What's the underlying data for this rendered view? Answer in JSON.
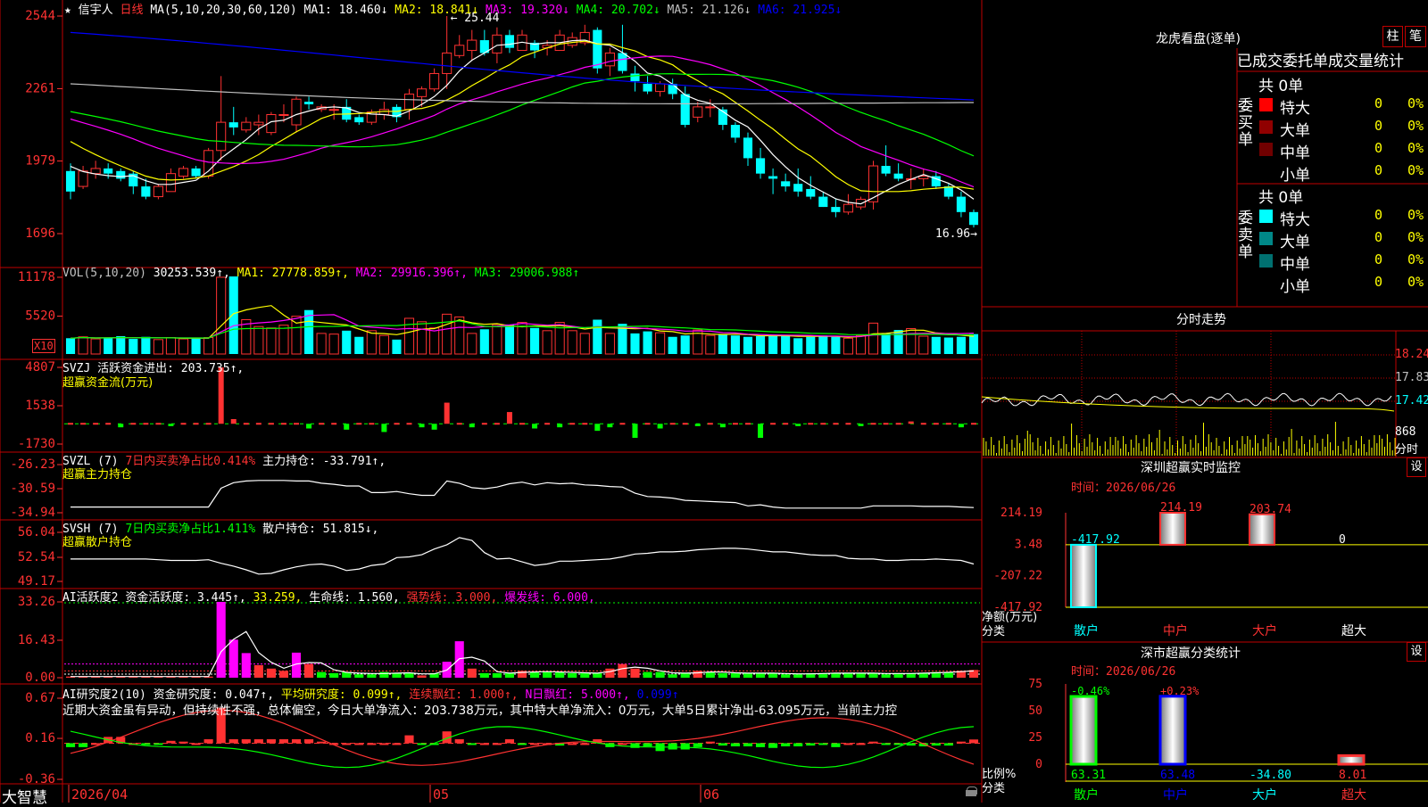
{
  "colors": {
    "up": "#ff3232",
    "down": "#00ffff",
    "grid": "#c00000",
    "ma1": "#ffffff",
    "ma2": "#ffff00",
    "ma3": "#ff00ff",
    "ma4": "#00ff00",
    "ma5": "#c0c0c0",
    "ma6": "#0000ff"
  },
  "header": {
    "star_icon": "★",
    "star_glyph": "★",
    "stock_name": "信宇人",
    "period": "日线",
    "ma_params": "MA(5,10,20,30,60,120)",
    "ma": [
      {
        "label": "MA1: 18.460↓",
        "color": "#ffffff"
      },
      {
        "label": "MA2: 18.841↓",
        "color": "#ffff00"
      },
      {
        "label": "MA3: 19.320↓",
        "color": "#ff00ff"
      },
      {
        "label": "MA4: 20.702↓",
        "color": "#00ff00"
      },
      {
        "label": "MA5: 21.126↓",
        "color": "#c0c0c0"
      },
      {
        "label": "MA6: 21.925↓",
        "color": "#0000ff"
      }
    ]
  },
  "price_axis": [
    "2544",
    "2261",
    "1979",
    "1696"
  ],
  "price_annotations": {
    "high": "25.44",
    "low": "16.96"
  },
  "vol": {
    "title": "VOL(5,10,20)",
    "value": "30253.539↑,",
    "ma1": "MA1: 27778.859↑,",
    "ma2": "MA2: 29916.396↑,",
    "ma3": "MA3: 29006.988↑",
    "axis": [
      "11178",
      "5520"
    ],
    "unit": "X10"
  },
  "svzj": {
    "title": "SVZJ  活跃资金进出: 203.735↑,",
    "subtitle": "超赢资金流(万元)",
    "axis": [
      "4807",
      "1538",
      "-1730"
    ]
  },
  "svzl": {
    "title": "SVZL (7)",
    "ratio": "7日内买卖净占比0.414%",
    "hold": "主力持仓: -33.791↑,",
    "subtitle": "超赢主力持仓",
    "axis": [
      "-26.23",
      "-30.59",
      "-34.94"
    ]
  },
  "svsh": {
    "title": "SVSH (7)",
    "ratio": "7日内买卖净占比1.411%",
    "hold": "散户持仓: 51.815↓,",
    "subtitle": "超赢散户持仓",
    "axis": [
      "56.04",
      "52.54",
      "49.17"
    ]
  },
  "ai1": {
    "title": "AI活跃度2",
    "activity": "资金活跃度: 3.445↑,",
    "v2": "33.259,",
    "life": "生命线: 1.560,",
    "strong": "强势线: 3.000,",
    "burst": "爆发线: 6.000,",
    "axis": [
      "33.26",
      "16.43",
      "0.00"
    ]
  },
  "ai2": {
    "title": "AI研究度2(10)",
    "research": "资金研究度: 0.047↑,",
    "avg": "平均研究度: 0.099↑,",
    "cont": "连续飘红: 1.000↑,",
    "nday": "N日飘红: 5.000↑,",
    "last": "0.099↑",
    "axis": [
      "0.67",
      "0.16",
      "-0.36"
    ],
    "commentary": "近期大资金虽有异动，但持续性不强，总体偏空，今日大单净流入：203.738万元，其中特大单净流入：0万元，大单5日累计净出-63.095万元，当前主力控"
  },
  "date_axis": [
    "2026/04",
    "05",
    "06"
  ],
  "brand": "大智慧",
  "lock_icon": "lock-icon",
  "right": {
    "lhb_title": "龙虎看盘(逐单)",
    "btn_zhu": "柱",
    "btn_bi": "笔",
    "tabs": [
      "已成交",
      "委托单",
      "成交量统计"
    ],
    "buy": {
      "side_label": "委买单",
      "total": "共 0单",
      "rows": [
        {
          "color": "#ff0000",
          "label": "特大",
          "count": "0",
          "pct": "0%"
        },
        {
          "color": "#900000",
          "label": "大单",
          "count": "0",
          "pct": "0%"
        },
        {
          "color": "#700000",
          "label": "中单",
          "count": "0",
          "pct": "0%"
        },
        {
          "color": "#000000",
          "label": "小单",
          "count": "0",
          "pct": "0%"
        }
      ]
    },
    "sell": {
      "side_label": "委卖单",
      "total": "共 0单",
      "rows": [
        {
          "color": "#00ffff",
          "label": "特大",
          "count": "0",
          "pct": "0%"
        },
        {
          "color": "#008888",
          "label": "大单",
          "count": "0",
          "pct": "0%"
        },
        {
          "color": "#007070",
          "label": "中单",
          "count": "0",
          "pct": "0%"
        },
        {
          "color": "#000000",
          "label": "小单",
          "count": "0",
          "pct": "0%"
        }
      ]
    },
    "fenshi_title": "分时走势",
    "fenshi_axis": [
      "18.24",
      "17.83",
      "17.42"
    ],
    "fenshi_vol": "868",
    "fenshi_unit": "分时",
    "sz_monitor": {
      "title": "深圳超赢实时监控",
      "btn": "设",
      "time": "时间：2026/06/26",
      "axis": [
        "214.19",
        "3.48",
        "-207.22",
        "-417.92"
      ],
      "y_label": "净额(万元)",
      "x_label": "分类",
      "bars": [
        {
          "cat": "散户",
          "value": -417.92,
          "label": "-417.92"
        },
        {
          "cat": "中户",
          "value": 214.19,
          "label": "214.19"
        },
        {
          "cat": "大户",
          "value": 203.74,
          "label": "203.74"
        },
        {
          "cat": "超大",
          "value": 0,
          "label": "0"
        }
      ]
    },
    "sz_class": {
      "title": "深市超赢分类统计",
      "btn": "设",
      "time": "时间：2026/06/26",
      "axis": [
        "75",
        "50",
        "25",
        "0"
      ],
      "y_label": "比例%",
      "x_label": "分类",
      "bars": [
        {
          "cat": "散户",
          "pct": "-0.46%",
          "value": 63.31,
          "label": "63.31"
        },
        {
          "cat": "中户",
          "pct": "+0.23%",
          "value": 63.48,
          "label": "63.48"
        },
        {
          "cat": "大户",
          "pct": "",
          "value": -34.8,
          "label": "-34.80"
        },
        {
          "cat": "超大",
          "pct": "",
          "value": 8.01,
          "label": "8.01"
        }
      ]
    }
  },
  "chart_data": [
    {
      "type": "candlestick",
      "name": "日线",
      "ylim": [
        16.96,
        25.44
      ],
      "ohlc": [
        [
          19.4,
          19.7,
          18.3,
          18.6
        ],
        [
          18.8,
          19.6,
          18.7,
          19.4
        ],
        [
          19.3,
          19.8,
          19.1,
          19.5
        ],
        [
          19.5,
          19.7,
          19.1,
          19.3
        ],
        [
          19.4,
          19.5,
          19.0,
          19.1
        ],
        [
          19.3,
          19.4,
          18.5,
          18.8
        ],
        [
          18.8,
          19.1,
          18.3,
          18.4
        ],
        [
          18.4,
          18.9,
          18.3,
          18.8
        ],
        [
          18.6,
          19.5,
          18.6,
          19.3
        ],
        [
          19.2,
          19.6,
          19.1,
          19.5
        ],
        [
          19.5,
          19.6,
          19.1,
          19.2
        ],
        [
          19.2,
          20.3,
          19.1,
          20.2
        ],
        [
          20.2,
          23.1,
          19.8,
          21.3
        ],
        [
          21.3,
          21.9,
          20.8,
          21.1
        ],
        [
          21.0,
          21.5,
          20.9,
          21.3
        ],
        [
          21.2,
          21.6,
          20.8,
          21.3
        ],
        [
          20.9,
          21.7,
          20.8,
          21.6
        ],
        [
          21.6,
          22.0,
          21.3,
          21.6
        ],
        [
          21.2,
          22.3,
          20.9,
          22.2
        ],
        [
          22.1,
          22.3,
          21.8,
          22.0
        ],
        [
          21.8,
          22.0,
          21.7,
          21.9
        ],
        [
          21.8,
          22.0,
          21.4,
          21.8
        ],
        [
          21.9,
          22.2,
          21.3,
          21.4
        ],
        [
          21.5,
          21.6,
          21.2,
          21.3
        ],
        [
          21.3,
          21.8,
          21.2,
          21.7
        ],
        [
          21.6,
          22.1,
          21.4,
          21.8
        ],
        [
          21.9,
          22.0,
          21.3,
          21.5
        ],
        [
          21.8,
          22.6,
          21.4,
          22.4
        ],
        [
          22.3,
          22.7,
          21.9,
          22.6
        ],
        [
          22.6,
          23.4,
          22.5,
          23.2
        ],
        [
          23.2,
          25.44,
          22.6,
          24.0
        ],
        [
          23.9,
          24.7,
          23.8,
          24.3
        ],
        [
          24.1,
          24.9,
          23.7,
          24.5
        ],
        [
          24.5,
          24.9,
          23.9,
          24.0
        ],
        [
          24.0,
          25.0,
          23.6,
          24.7
        ],
        [
          24.7,
          24.9,
          24.0,
          24.2
        ],
        [
          24.1,
          24.9,
          24.1,
          24.7
        ],
        [
          24.4,
          24.5,
          23.8,
          24.1
        ],
        [
          24.2,
          24.5,
          23.9,
          24.3
        ],
        [
          24.1,
          24.9,
          24.1,
          24.7
        ],
        [
          24.3,
          24.8,
          24.2,
          24.6
        ],
        [
          24.4,
          25.1,
          24.3,
          24.8
        ],
        [
          24.9,
          25.0,
          23.2,
          23.4
        ],
        [
          23.5,
          24.2,
          23.1,
          24.0
        ],
        [
          24.0,
          25.1,
          23.2,
          23.3
        ],
        [
          23.2,
          23.5,
          22.5,
          22.9
        ],
        [
          22.8,
          23.1,
          22.4,
          22.5
        ],
        [
          22.5,
          22.9,
          22.3,
          22.8
        ],
        [
          22.8,
          23.0,
          22.2,
          22.4
        ],
        [
          22.4,
          22.7,
          21.1,
          21.2
        ],
        [
          21.5,
          22.1,
          21.3,
          21.9
        ],
        [
          21.9,
          22.2,
          21.5,
          21.9
        ],
        [
          21.8,
          21.9,
          21.0,
          21.2
        ],
        [
          21.2,
          21.3,
          20.5,
          20.7
        ],
        [
          20.7,
          20.9,
          19.6,
          19.9
        ],
        [
          19.9,
          20.3,
          19.1,
          19.3
        ],
        [
          19.2,
          19.5,
          18.5,
          19.1
        ],
        [
          19.0,
          19.3,
          18.6,
          18.8
        ],
        [
          18.9,
          19.5,
          18.4,
          18.6
        ],
        [
          18.7,
          19.2,
          18.3,
          18.4
        ],
        [
          18.4,
          18.6,
          18.0,
          18.0
        ],
        [
          18.0,
          18.3,
          17.6,
          17.8
        ],
        [
          17.8,
          18.5,
          17.7,
          18.1
        ],
        [
          18.0,
          18.4,
          17.9,
          18.3
        ],
        [
          18.2,
          19.8,
          17.9,
          19.6
        ],
        [
          19.6,
          20.4,
          19.2,
          19.3
        ],
        [
          19.3,
          19.7,
          19.0,
          19.1
        ],
        [
          19.1,
          19.5,
          18.7,
          19.1
        ],
        [
          19.1,
          19.5,
          18.8,
          19.2
        ],
        [
          19.2,
          19.4,
          18.7,
          18.8
        ],
        [
          18.8,
          18.9,
          18.3,
          18.4
        ],
        [
          18.4,
          18.6,
          17.6,
          17.8
        ],
        [
          17.8,
          17.9,
          17.2,
          17.3
        ]
      ]
    },
    {
      "type": "bar",
      "name": "VOL",
      "values": [
        23000,
        25000,
        22000,
        24000,
        26000,
        22000,
        25000,
        21000,
        24000,
        22000,
        23000,
        24000,
        111780,
        113000,
        50000,
        40000,
        38000,
        42000,
        55000,
        64000,
        30000,
        29000,
        34000,
        25000,
        34000,
        27000,
        21000,
        52000,
        47000,
        38000,
        58000,
        54000,
        30000,
        36000,
        43000,
        43000,
        46000,
        38000,
        34000,
        46000,
        34000,
        30000,
        50000,
        30000,
        44000,
        30000,
        33000,
        31000,
        25000,
        27000,
        35000,
        27000,
        28000,
        27000,
        25000,
        26000,
        27000,
        28000,
        23000,
        25000,
        27000,
        25000,
        23000,
        27000,
        45000,
        30000,
        35000,
        37000,
        26000,
        25000,
        24000,
        25000,
        29000
      ]
    },
    {
      "type": "bar",
      "name": "SVZJ",
      "values": [
        0,
        0,
        0,
        0,
        -300,
        0,
        0,
        0,
        -200,
        0,
        0,
        0,
        4807,
        400,
        0,
        0,
        0,
        0,
        0,
        -400,
        0,
        0,
        -500,
        0,
        0,
        -700,
        0,
        0,
        -300,
        -500,
        1800,
        0,
        -300,
        0,
        0,
        1000,
        0,
        -400,
        0,
        -300,
        0,
        0,
        -600,
        -300,
        0,
        -1200,
        0,
        -400,
        0,
        0,
        -200,
        0,
        -300,
        0,
        0,
        -1200,
        0,
        0,
        -200,
        0,
        0,
        0,
        0,
        -200,
        0,
        0,
        0,
        200,
        0,
        0,
        0,
        -300,
        0
      ]
    },
    {
      "type": "line",
      "name": "SVZL",
      "ylim": [
        -34.94,
        -26.23
      ],
      "values": [
        -33.9,
        -33.9,
        -33.9,
        -33.9,
        -33.9,
        -33.9,
        -33.9,
        -33.9,
        -33.9,
        -33.9,
        -33.9,
        -33.9,
        -30.5,
        -29.5,
        -29.2,
        -29.1,
        -29.1,
        -29.1,
        -29.2,
        -29.2,
        -29.6,
        -29.8,
        -30.1,
        -30.1,
        -31.3,
        -31.3,
        -31.1,
        -31.5,
        -31.8,
        -31.8,
        -29.2,
        -29.6,
        -30.4,
        -30.6,
        -30.3,
        -29.7,
        -29.4,
        -29.9,
        -29.5,
        -29.7,
        -29.6,
        -29.9,
        -30.0,
        -30.2,
        -30.3,
        -31.4,
        -32.0,
        -32.1,
        -32.3,
        -32.7,
        -32.8,
        -32.9,
        -33.0,
        -33.1,
        -33.7,
        -33.5,
        -33.9,
        -34.1,
        -34.1,
        -34.1,
        -34.1,
        -34.1,
        -34.1,
        -34.1,
        -33.7,
        -33.7,
        -33.7,
        -33.7,
        -33.8,
        -33.8,
        -33.8,
        -33.9,
        -34.0
      ]
    },
    {
      "type": "line",
      "name": "SVSH",
      "ylim": [
        49.17,
        56.04
      ],
      "values": [
        52.3,
        52.3,
        52.3,
        52.3,
        52.3,
        52.3,
        52.3,
        52.2,
        52.1,
        52.1,
        52.1,
        52.2,
        51.7,
        51.3,
        50.8,
        50.2,
        50.3,
        50.8,
        51.2,
        51.5,
        51.6,
        51.3,
        50.7,
        50.9,
        51.4,
        51.6,
        52.5,
        52.6,
        52.9,
        53.7,
        54.3,
        55.3,
        54.9,
        53.2,
        52.3,
        52.4,
        51.9,
        51.4,
        51.6,
        52.0,
        52.0,
        52.1,
        52.2,
        52.3,
        52.6,
        53.0,
        53.1,
        53.3,
        53.3,
        53.4,
        53.6,
        53.7,
        53.8,
        53.8,
        53.7,
        53.5,
        53.3,
        53.3,
        53.1,
        52.9,
        52.8,
        52.8,
        52.4,
        52.3,
        52.3,
        52.1,
        52.1,
        52.2,
        52.2,
        52.3,
        52.2,
        52.1,
        51.6
      ]
    },
    {
      "type": "bar",
      "name": "AI活跃度2",
      "values": [
        0.5,
        0.5,
        0.5,
        0.5,
        0.5,
        0.5,
        0.5,
        0.5,
        0.5,
        0.5,
        0.5,
        0.5,
        33.26,
        16.7,
        10.8,
        5.5,
        4.0,
        3.0,
        11.0,
        6.0,
        2.5,
        2.0,
        2.5,
        1.5,
        1.5,
        2.5,
        2.0,
        2.0,
        1.0,
        2.0,
        7.0,
        16.0,
        4.0,
        2.0,
        2.0,
        2.0,
        3.0,
        2.5,
        2.5,
        2.5,
        2.0,
        2.0,
        2.0,
        4.0,
        6.0,
        4.0,
        2.5,
        2.5,
        1.5,
        2.0,
        3.0,
        2.5,
        2.0,
        2.0,
        2.0,
        2.0,
        2.0,
        1.5,
        1.5,
        2.0,
        2.0,
        2.0,
        2.0,
        2.0,
        2.0,
        1.5,
        2.0,
        2.0,
        2.0,
        2.5,
        2.5,
        3.0,
        3.4
      ]
    },
    {
      "type": "bar",
      "name": "AI研究度2",
      "values": [
        -0.05,
        -0.05,
        0,
        0.08,
        0.08,
        0,
        -0.02,
        -0.02,
        0.03,
        0.02,
        0,
        0.05,
        0.45,
        0.05,
        0.05,
        0.05,
        0.05,
        0.05,
        0.05,
        0.05,
        0.02,
        0,
        0,
        0,
        0,
        0,
        0,
        0.1,
        -0.02,
        -0.02,
        0.15,
        0.05,
        -0.02,
        0,
        0,
        0.05,
        -0.02,
        0,
        0,
        -0.03,
        0,
        0,
        0.05,
        -0.05,
        0,
        -0.06,
        -0.04,
        -0.1,
        -0.08,
        -0.08,
        -0.05,
        0.02,
        -0.03,
        -0.04,
        -0.04,
        -0.05,
        -0.06,
        -0.04,
        -0.04,
        -0.03,
        -0.02,
        -0.05,
        0,
        0,
        0.02,
        -0.02,
        -0.02,
        -0.03,
        -0.04,
        -0.03,
        -0.03,
        0.02,
        0.047
      ]
    }
  ]
}
